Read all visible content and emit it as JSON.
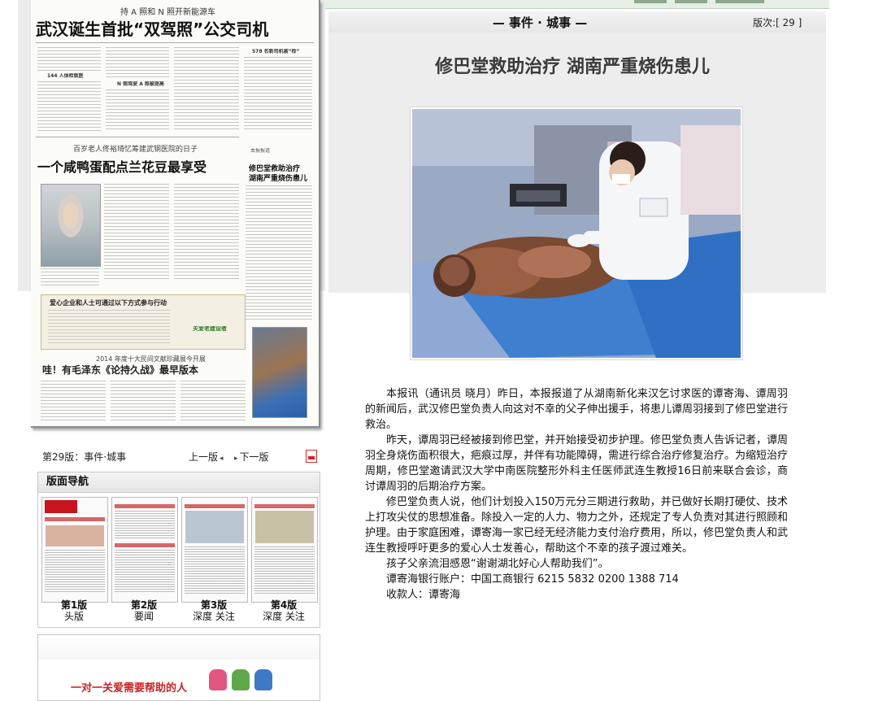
{
  "section_header": {
    "title": "— 事件 · 城事 —",
    "page_number": "版次:[ 29 ]"
  },
  "article": {
    "title": "修巴堂救助治疗  湖南严重烧伤患儿",
    "paragraphs": [
      "本报讯（通讯员 晓月）昨日，本报报道了从湖南新化来汉乞讨求医的谭寄海、谭周羽的新闻后，武汉修巴堂负责人向这对不幸的父子伸出援手，将患儿谭周羽接到了修巴堂进行救治。",
      "昨天，谭周羽已经被接到修巴堂，并开始接受初步护理。修巴堂负责人告诉记者，谭周羽全身烧伤面积很大，疤痕过厚，并伴有功能障碍，需进行综合治疗修复治疗。为缩短治疗周期，修巴堂邀请武汉大学中南医院整形外科主任医师武连生教授16日前来联合会诊，商讨谭周羽的后期治疗方案。",
      "修巴堂负责人说，他们计划投入150万元分三期进行救助，并已做好长期打硬仗、技术上打攻尖仗的思想准备。除投入一定的人力、物力之外，还规定了专人负责对其进行照顾和护理。由于家庭困难，谭寄海一家已经无经济能力支付治疗费用，所以，修巴堂负责人和武连生教授呼吁更多的爱心人士发善心，帮助这个不幸的孩子渡过难关。",
      "孩子父亲流泪感恩“谢谢湖北好心人帮助我们”。",
      "谭寄海银行账户：中国工商银行 6215 5832 0200 1388 714",
      "收款人：谭寄海"
    ]
  },
  "scan": {
    "top_kicker": "持 A 照和 N 照开新能源车",
    "headline_1": "武汉诞生首批“双驾照”公交司机",
    "kicker_2": "百岁老人佟裕琦忆筹建武钢医院的日子",
    "headline_2": "一个咸鸭蛋配点兰花豆最享受",
    "side_tag": "本报报道",
    "side_headline_1": "修巴堂救助治疗",
    "side_headline_2": "湖南严重烧伤患儿",
    "ad_title": "爱心企业和人士可通过以下方式参与行动",
    "ad_logo_text": "关爱老建设者",
    "kicker_3": "2014 年度十大民间文献珍藏展今开展",
    "headline_3": "哇！有毛泽东《论持久战》最早版本",
    "col_head_1": "144 人体检就医",
    "col_head_2": "N 照驾驶 A 照被提高",
    "col_head_3": "578 名新司机被“检”"
  },
  "pager": {
    "label": "第29版：事件·城事",
    "prev": "上一版",
    "next": "下一版"
  },
  "nav": {
    "title": "版面导航",
    "pages": [
      {
        "num": "第1版",
        "name": "头版"
      },
      {
        "num": "第2版",
        "name": "要闻"
      },
      {
        "num": "第3版",
        "name": "深度 关注"
      },
      {
        "num": "第4版",
        "name": "深度 关注"
      }
    ]
  },
  "banner": {
    "text": "一对一关爱需要帮助的人"
  },
  "icons": {
    "prev_arrow": "chevron-left-icon",
    "next_arrow": "chevron-right-icon",
    "pdf": "pdf-icon"
  },
  "colors": {
    "masthead_red": "#c8141c",
    "banner_red": "#cc2222",
    "header_bg": "#ececec"
  }
}
